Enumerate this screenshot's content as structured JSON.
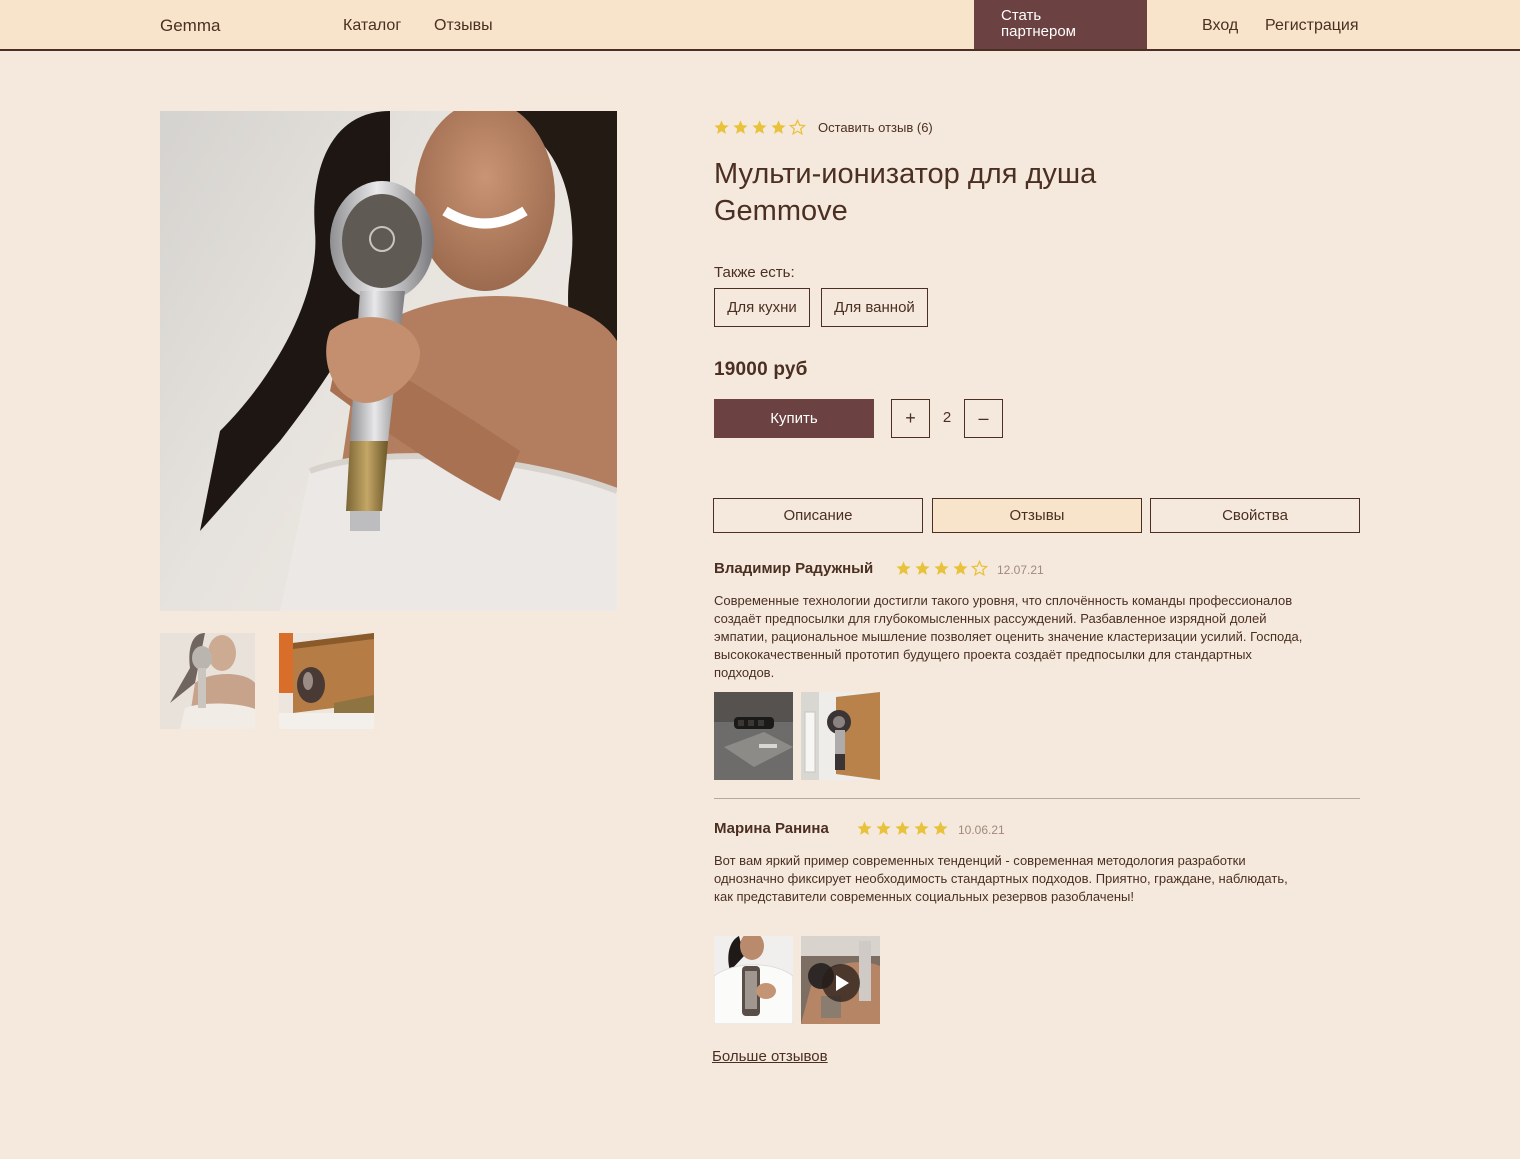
{
  "header": {
    "logo": "Gemma",
    "nav": [
      {
        "label": "Каталог"
      },
      {
        "label": "Отзывы"
      }
    ],
    "partner_button": "Стать партнером",
    "login": "Вход",
    "register": "Регистрация"
  },
  "product": {
    "rating": 4,
    "rating_max": 5,
    "review_link": "Оставить отзыв (6)",
    "title": "Мульти-ионизатор для душа Gemmove",
    "also_label": "Также есть:",
    "variants": [
      "Для кухни",
      "Для ванной"
    ],
    "price": "19000 руб",
    "buy_label": "Купить",
    "qty_plus": "+",
    "qty_minus": "–",
    "quantity": "2"
  },
  "tabs": [
    {
      "label": "Описание",
      "active": false
    },
    {
      "label": "Отзывы",
      "active": true
    },
    {
      "label": "Свойства",
      "active": false
    }
  ],
  "reviews": [
    {
      "author": "Владимир Радужный",
      "rating": 4,
      "date": "12.07.21",
      "text": "Современные технологии достигли такого уровня, что сплочённость команды профессионалов создаёт предпосылки для глубокомысленных рассуждений. Разбавленное изрядной долей эмпатии, рациональное мышление позволяет оценить значение кластеризации усилий. Господа, высококачественный прототип будущего проекта создаёт предпосылки для стандартных подходов."
    },
    {
      "author": "Марина Ранина",
      "rating": 5,
      "date": "10.06.21",
      "text": "Вот вам яркий пример современных тенденций - современная методология разработки однозначно фиксирует необходимость стандартных подходов. Приятно, граждане, наблюдать, как представители современных социальных резервов разоблачены!"
    }
  ],
  "more_reviews": "Больше отзывов",
  "colors": {
    "background": "#f5e9dd",
    "header_bg": "#f8e4ca",
    "accent": "#6b4141",
    "text": "#4a2f22",
    "star": "#e8c23a"
  },
  "icons": [
    "star-icon",
    "star-outline-icon",
    "play-icon"
  ]
}
